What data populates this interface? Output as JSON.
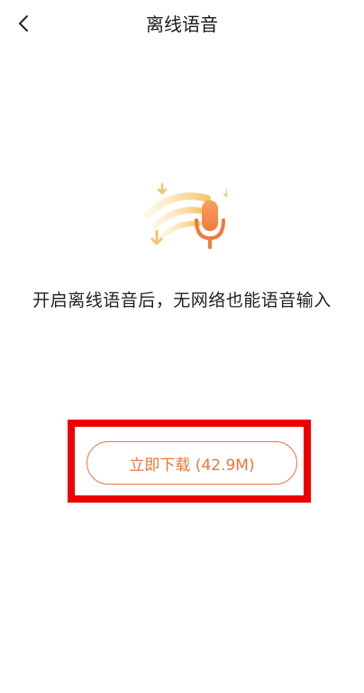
{
  "header": {
    "back_icon": "chevron-left-icon",
    "title": "离线语音"
  },
  "hero": {
    "icon": "offline-voice-mic-wifi-icon",
    "colors": {
      "mic": "#f08a4b",
      "waves": "#f6c36a"
    }
  },
  "main": {
    "description": "开启离线语音后，无网络也能语音输入",
    "download_button_label": "立即下载 (42.9M)"
  },
  "colors": {
    "accent": "#e8773a",
    "highlight": "#ee0000"
  }
}
